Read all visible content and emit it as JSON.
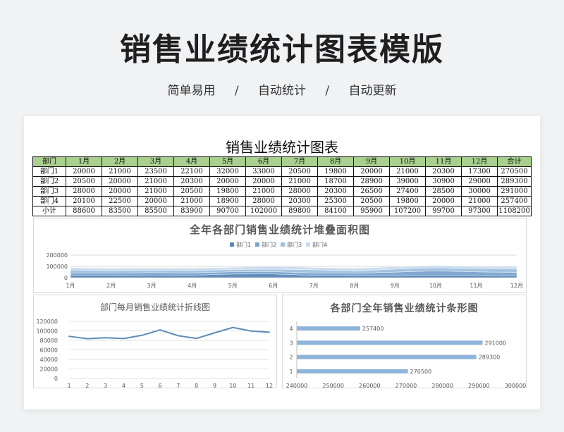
{
  "page": {
    "title": "销售业绩统计图表模版",
    "features": [
      "简单易用",
      "自动统计",
      "自动更新"
    ],
    "separator": "/"
  },
  "sheet": {
    "title": "销售业绩统计图表",
    "columns": [
      "部门",
      "1月",
      "2月",
      "3月",
      "4月",
      "5月",
      "6月",
      "7月",
      "8月",
      "9月",
      "10月",
      "11月",
      "12月",
      "合计"
    ],
    "rows": [
      [
        "部门1",
        "20000",
        "21000",
        "23500",
        "22100",
        "32000",
        "33000",
        "20500",
        "19800",
        "20000",
        "21000",
        "20300",
        "17300",
        "270500"
      ],
      [
        "部门2",
        "20500",
        "20000",
        "21000",
        "20300",
        "20000",
        "20000",
        "21000",
        "18700",
        "28900",
        "39000",
        "30900",
        "29000",
        "289300"
      ],
      [
        "部门3",
        "28000",
        "20000",
        "21000",
        "20500",
        "19800",
        "21000",
        "28000",
        "20300",
        "26500",
        "27400",
        "28500",
        "30000",
        "291000"
      ],
      [
        "部门4",
        "20100",
        "22500",
        "20000",
        "21000",
        "18900",
        "28000",
        "20300",
        "25300",
        "20500",
        "19800",
        "20000",
        "21000",
        "257400"
      ],
      [
        "小计",
        "88600",
        "83500",
        "85500",
        "83900",
        "90700",
        "102000",
        "89800",
        "84100",
        "95900",
        "107200",
        "99700",
        "97300",
        "1108200"
      ]
    ]
  },
  "colors": {
    "header_bg": "#a9d08e",
    "series": [
      "#5b87b5",
      "#7aa4cf",
      "#9fc0e0",
      "#c9dbee"
    ],
    "line": "#5b8db8",
    "bar": "#8eb4dc"
  },
  "chart_data": [
    {
      "type": "area",
      "stacked": true,
      "title": "全年各部门销售业绩统计堆叠面积图",
      "categories": [
        "1月",
        "2月",
        "3月",
        "4月",
        "5月",
        "6月",
        "7月",
        "8月",
        "9月",
        "10月",
        "11月",
        "12月"
      ],
      "series": [
        {
          "name": "部门1",
          "values": [
            20000,
            21000,
            23500,
            22100,
            32000,
            33000,
            20500,
            19800,
            20000,
            21000,
            20300,
            17300
          ]
        },
        {
          "name": "部门2",
          "values": [
            20500,
            20000,
            21000,
            20300,
            20000,
            20000,
            21000,
            18700,
            28900,
            39000,
            30900,
            29000
          ]
        },
        {
          "name": "部门3",
          "values": [
            28000,
            20000,
            21000,
            20500,
            19800,
            21000,
            28000,
            20300,
            26500,
            27400,
            28500,
            30000
          ]
        },
        {
          "name": "部门4",
          "values": [
            20100,
            22500,
            20000,
            21000,
            18900,
            28000,
            20300,
            25300,
            20500,
            19800,
            20000,
            21000
          ]
        }
      ],
      "ylim": [
        0,
        200000
      ],
      "yticks": [
        0,
        100000,
        200000
      ],
      "legend": "top",
      "grid": true
    },
    {
      "type": "line",
      "title": "部门每月销售业绩统计折线图",
      "x": [
        1,
        2,
        3,
        4,
        5,
        6,
        7,
        8,
        9,
        10,
        11,
        12
      ],
      "values": [
        88600,
        83500,
        85500,
        83900,
        90700,
        102000,
        89800,
        84100,
        95900,
        107200,
        99700,
        97300
      ],
      "ylim": [
        0,
        120000
      ],
      "yticks": [
        0,
        20000,
        40000,
        60000,
        80000,
        100000,
        120000
      ],
      "grid": true
    },
    {
      "type": "bar",
      "orientation": "horizontal",
      "title": "各部门全年销售业绩统计条形图",
      "categories": [
        "1",
        "2",
        "3",
        "4"
      ],
      "values": [
        270500,
        289300,
        291000,
        257400
      ],
      "xlim": [
        240000,
        300000
      ],
      "xticks": [
        240000,
        250000,
        260000,
        270000,
        280000,
        290000,
        300000
      ],
      "data_labels": true
    }
  ]
}
